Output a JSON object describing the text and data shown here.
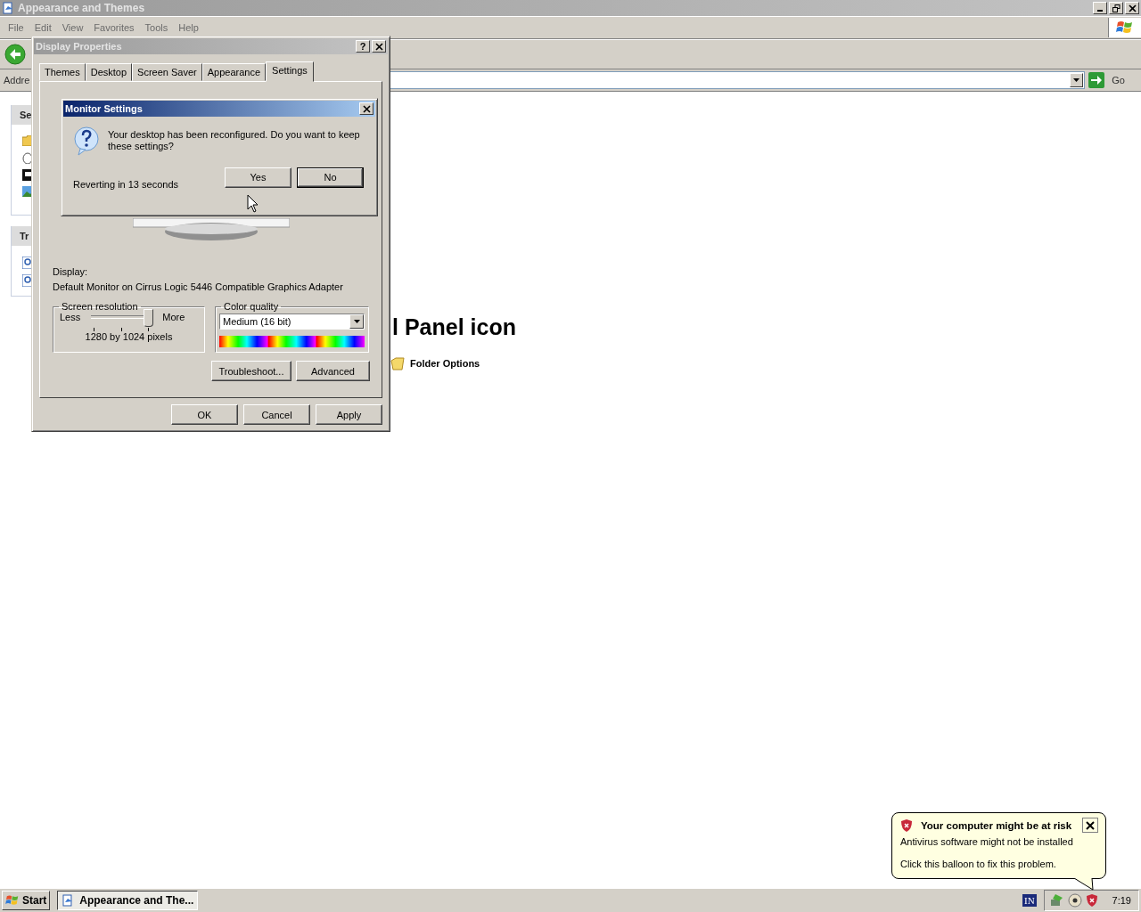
{
  "explorer": {
    "title": "Appearance and Themes",
    "menu": [
      "File",
      "Edit",
      "View",
      "Favorites",
      "Tools",
      "Help"
    ],
    "address_label": "Addre",
    "go_label": "Go",
    "sidebar_headers": [
      "Se",
      "Tr"
    ],
    "heading": "l Panel icon",
    "items": [
      {
        "label": "Folder Options"
      }
    ]
  },
  "display_properties": {
    "title": "Display Properties",
    "help_button": "?",
    "tabs": [
      {
        "label": "Themes",
        "selected": false
      },
      {
        "label": "Desktop",
        "selected": false
      },
      {
        "label": "Screen Saver",
        "selected": false
      },
      {
        "label": "Appearance",
        "selected": false
      },
      {
        "label": "Settings",
        "selected": true
      }
    ],
    "display_label": "Display:",
    "display_value": "Default Monitor on Cirrus Logic 5446 Compatible Graphics Adapter",
    "resolution": {
      "title": "Screen resolution",
      "less": "Less",
      "more": "More",
      "level": 1,
      "reading": "1280 by 1024 pixels"
    },
    "color_quality": {
      "title": "Color quality",
      "value": "Medium (16 bit)"
    },
    "buttons": [
      "Troubleshoot...",
      "Advanced"
    ],
    "footer_buttons": [
      "OK",
      "Cancel",
      "Apply"
    ]
  },
  "monitor_settings": {
    "title": "Monitor Settings",
    "message": "Your desktop has been reconfigured.  Do you want to keep these settings?",
    "countdown": "Reverting in 13 seconds",
    "buttons": [
      {
        "label": "Yes",
        "default": false
      },
      {
        "label": "No",
        "default": true
      }
    ]
  },
  "taskbar": {
    "start": "Start",
    "tasks": [
      {
        "label": "Appearance and The...",
        "selected": true
      }
    ],
    "language": "IN",
    "clock": "7:19"
  },
  "balloon": {
    "title": "Your computer might be at risk",
    "lines": [
      "Antivirus software might not be installed",
      "Click this balloon to fix this problem."
    ]
  }
}
